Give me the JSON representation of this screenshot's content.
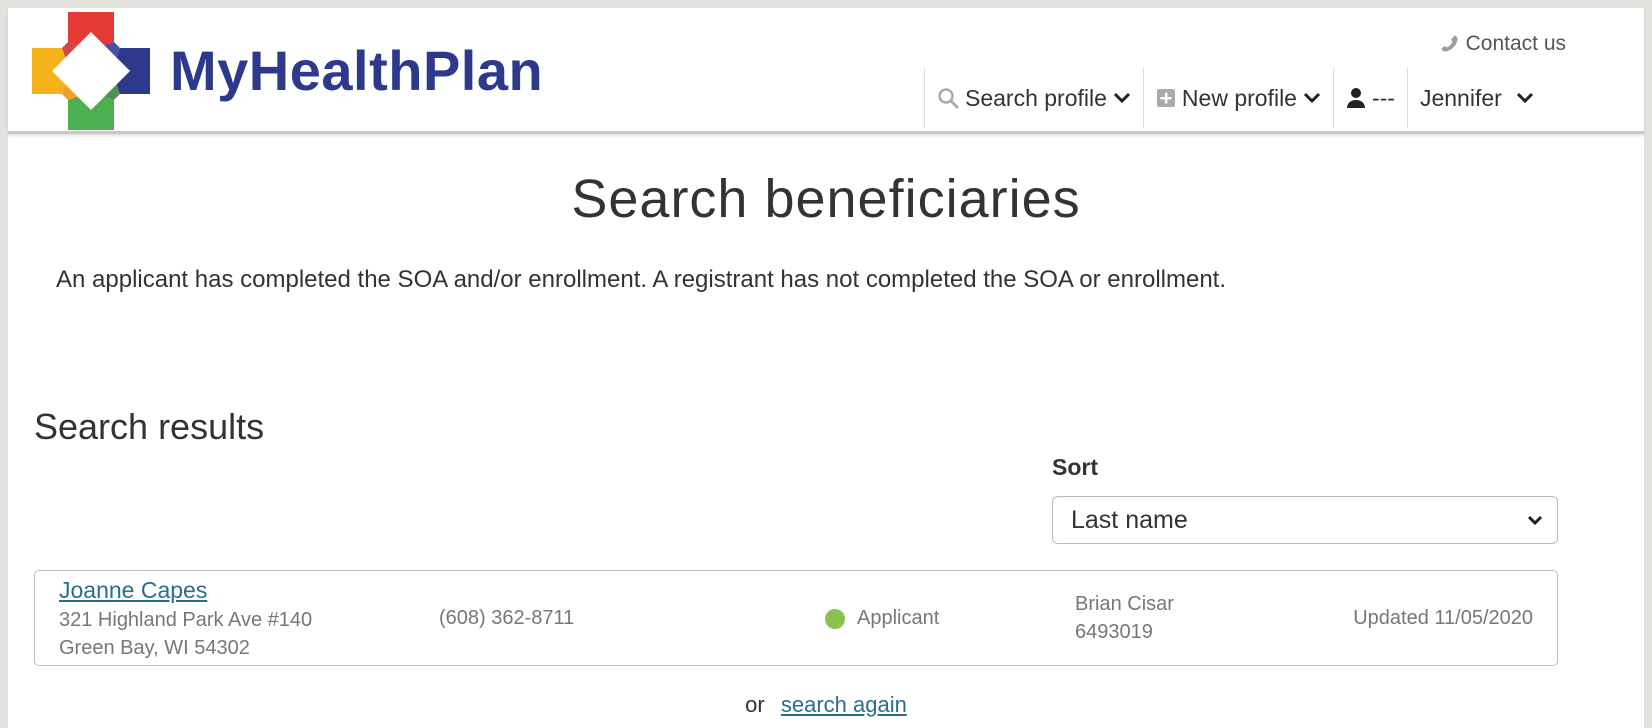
{
  "header": {
    "brand": "MyHealthPlan",
    "contact_label": "Contact us",
    "nav": {
      "search_profile": "Search profile",
      "new_profile": "New profile",
      "user_status": "---",
      "user_name": "Jennifer"
    }
  },
  "main": {
    "title": "Search beneficiaries",
    "intro": "An applicant has completed the SOA and/or enrollment. A registrant has not completed the SOA or enrollment.",
    "results_heading": "Search results",
    "sort": {
      "label": "Sort",
      "selected": "Last name"
    },
    "results": [
      {
        "name": "Joanne Capes",
        "address_line1": "321 Highland Park Ave #140",
        "address_line2": "Green Bay, WI 54302",
        "phone": "(608) 362-8711",
        "status": "Applicant",
        "status_color": "#8cc152",
        "agent_name": "Brian Cisar",
        "agent_id": "6493019",
        "updated": "Updated 11/05/2020"
      }
    ],
    "footer_prefix": "or",
    "search_again_label": "search again"
  },
  "colors": {
    "brand": "#2d3a8c",
    "link": "#2b6d8c",
    "logo_red": "#e53935",
    "logo_yellow": "#f5b21b",
    "logo_green": "#4caf50",
    "logo_navy": "#2d3a8c"
  },
  "icons": [
    "logo-cross-icon",
    "phone-icon",
    "search-icon",
    "plus-square-icon",
    "user-icon",
    "chevron-down-icon"
  ]
}
